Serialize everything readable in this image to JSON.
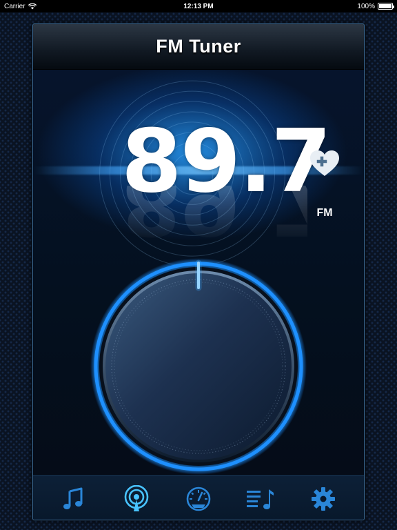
{
  "status_bar": {
    "carrier": "Carrier",
    "time": "12:13 PM",
    "battery": "100%",
    "battery_level": 1.0
  },
  "header": {
    "title": "FM Tuner"
  },
  "tuner": {
    "frequency": "89.7",
    "band": "FM",
    "favorite_icon": "heart-plus-icon"
  },
  "tabs": [
    {
      "name": "music",
      "icon": "music-note-icon",
      "active": false
    },
    {
      "name": "radio",
      "icon": "broadcast-icon",
      "active": true
    },
    {
      "name": "speedometer",
      "icon": "speedometer-icon",
      "active": false
    },
    {
      "name": "playlist",
      "icon": "playlist-icon",
      "active": false
    },
    {
      "name": "settings",
      "icon": "gear-icon",
      "active": false
    }
  ],
  "colors": {
    "accent": "#1e90ff",
    "tab_icon": "#2a86d8",
    "tab_icon_active": "#48c3ff",
    "favorite": "#e8eef4"
  }
}
